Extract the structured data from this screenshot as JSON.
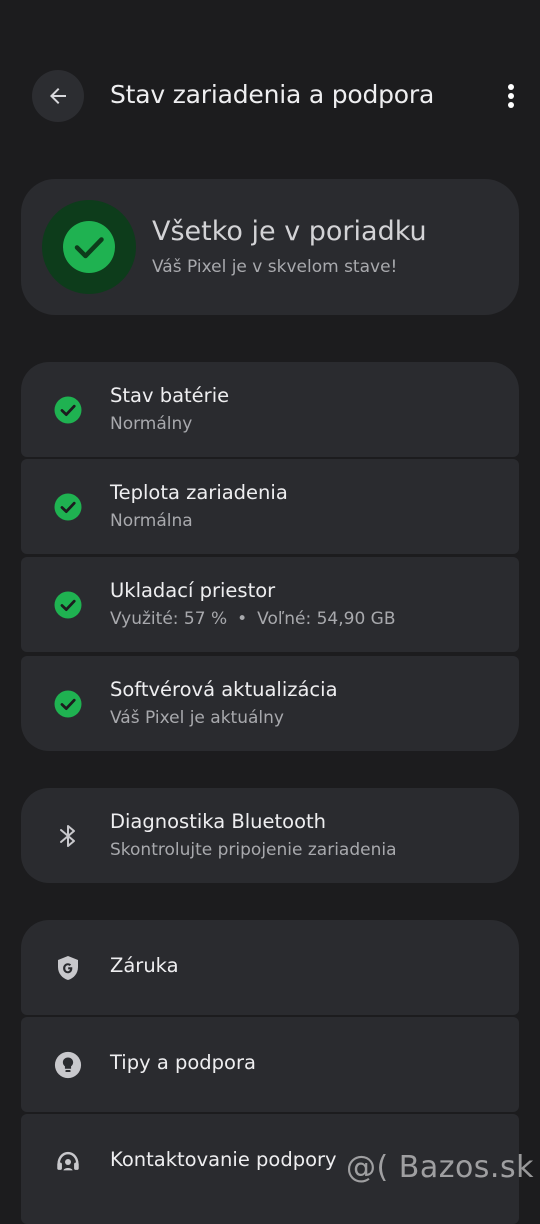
{
  "header": {
    "title": "Stav zariadenia a podpora",
    "back_icon": "arrow-back-icon",
    "more_icon": "more-vert-icon"
  },
  "summary": {
    "title": "Všetko je v poriadku",
    "subtitle": "Váš Pixel je v skvelom stave!",
    "status_color": "#1fb251"
  },
  "checks": [
    {
      "title": "Stav batérie",
      "subtitle": "Normálny"
    },
    {
      "title": "Teplota zariadenia",
      "subtitle": "Normálna"
    },
    {
      "title": "Ukladací priestor",
      "used": "Využité: 57 %",
      "separator": "•",
      "free": "Voľné: 54,90 GB"
    },
    {
      "title": "Softvérová aktualizácia",
      "subtitle": "Váš Pixel je aktuálny"
    }
  ],
  "bluetooth": {
    "title": "Diagnostika Bluetooth",
    "subtitle": "Skontrolujte pripojenie zariadenia",
    "icon": "bluetooth-icon"
  },
  "support": [
    {
      "title": "Záruka",
      "icon": "google-shield-icon"
    },
    {
      "title": "Tipy a podpora",
      "icon": "lightbulb-icon"
    },
    {
      "title": "Kontaktovanie podpory",
      "icon": "headset-icon"
    }
  ],
  "watermark": "@( Bazos.sk"
}
